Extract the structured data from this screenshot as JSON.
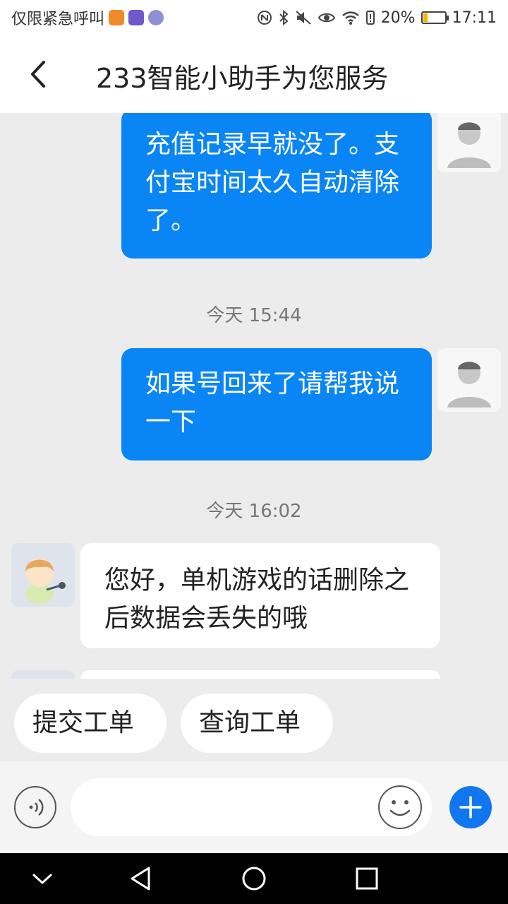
{
  "status_bar": {
    "emergency_text": "仅限紧急呼叫",
    "battery_percent": "20%",
    "battery_level": 0.2,
    "time": "17:11"
  },
  "header": {
    "title": "233智能小助手为您服务"
  },
  "messages": [
    {
      "sender": "user",
      "text": "充值记录早就没了。支付宝时间太久自动清除了。"
    },
    {
      "timestamp": "今天  15:44"
    },
    {
      "sender": "user",
      "text": "如果号回来了请帮我说一下"
    },
    {
      "timestamp": "今天  16:02"
    },
    {
      "sender": "assistant",
      "text": "您好，单机游戏的话删除之后数据会丢失的哦"
    }
  ],
  "quick_actions": [
    "提交工单",
    "查询工单"
  ],
  "input": {
    "value": "",
    "placeholder": ""
  },
  "colors": {
    "user_bubble": "#0a85f5",
    "plus_button": "#1177f0",
    "chat_background": "#ececec"
  },
  "icons": {
    "back": "chevron-left-icon",
    "voice": "voice-wave-icon",
    "emoji": "smiley-icon",
    "plus": "plus-icon",
    "nav_down": "chevron-down-icon",
    "nav_back": "triangle-back-icon",
    "nav_home": "circle-home-icon",
    "nav_recents": "square-recents-icon"
  }
}
